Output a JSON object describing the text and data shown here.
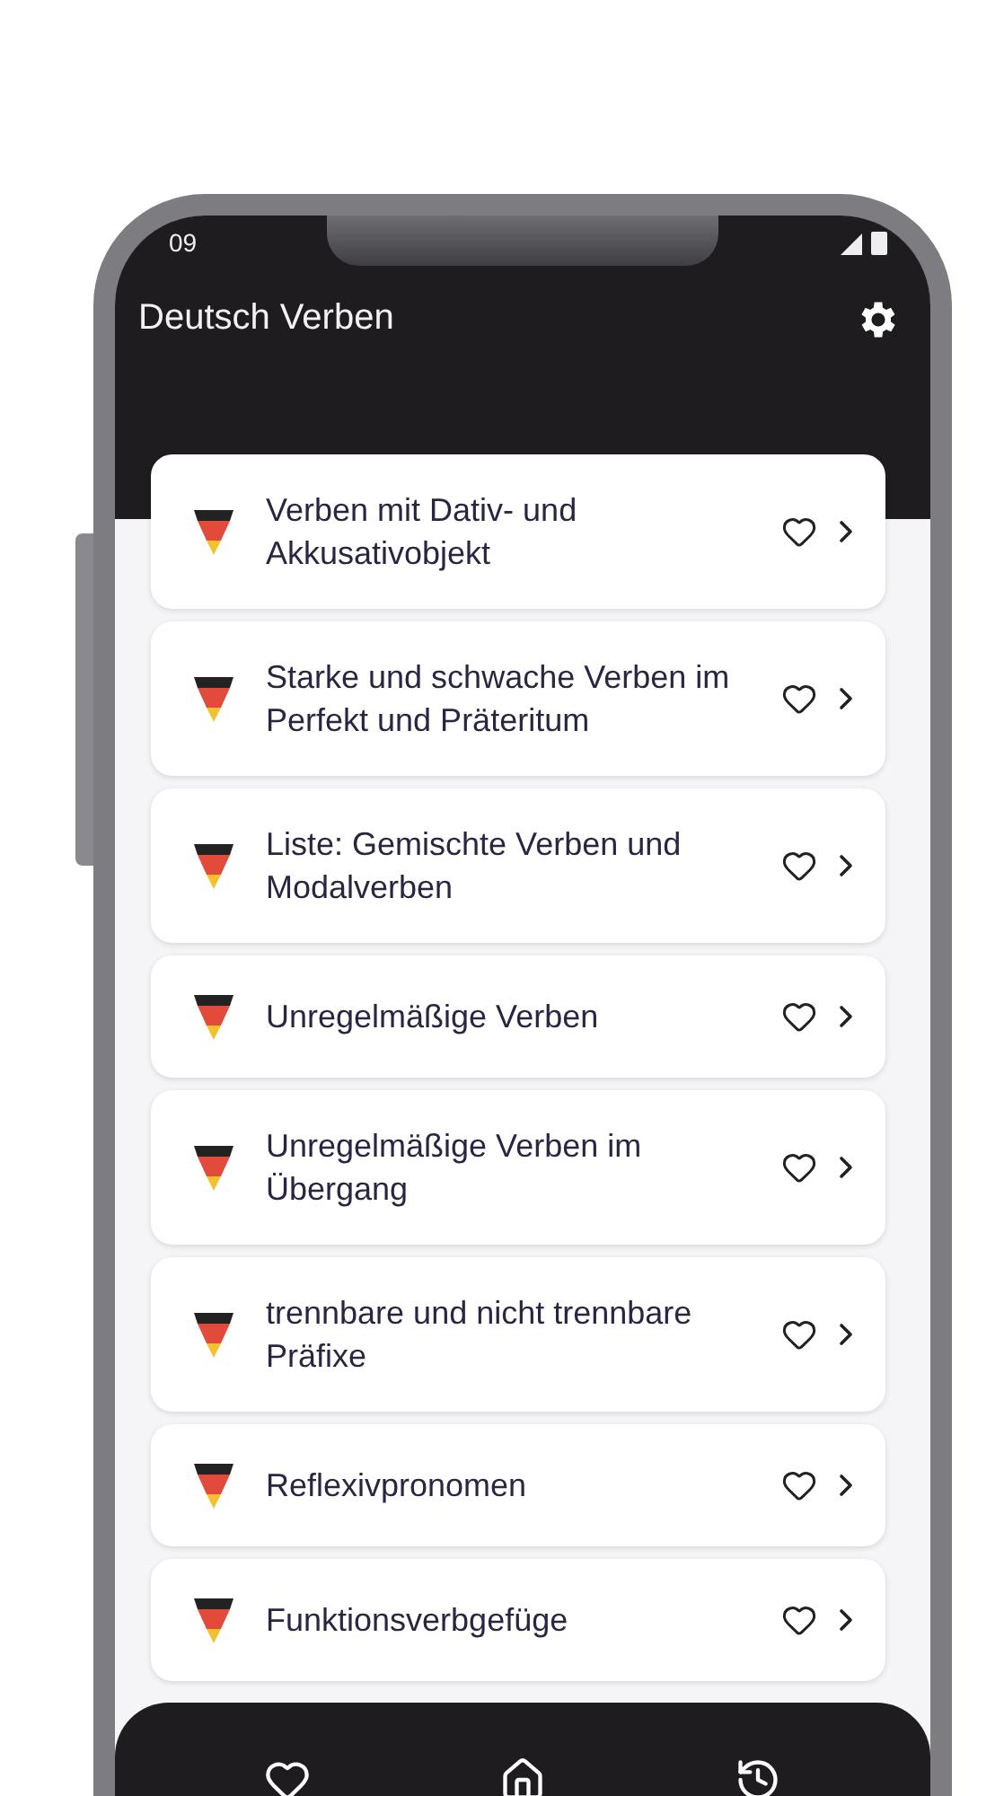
{
  "status_bar": {
    "time": "09"
  },
  "app_bar": {
    "title": "Deutsch Verben"
  },
  "topics": [
    {
      "title": "Verben mit Dativ- und Akkusativobjekt"
    },
    {
      "title": "Starke und schwache Verben im Perfekt und Präteritum"
    },
    {
      "title": "Liste: Gemischte Verben und Modalverben"
    },
    {
      "title": "Unregelmäßige Verben"
    },
    {
      "title": "Unregelmäßige Verben im Übergang"
    },
    {
      "title": "trennbare und nicht trennbare Präfixe"
    },
    {
      "title": "Reflexivpronomen"
    },
    {
      "title": "Funktionsverbgefüge"
    }
  ],
  "bottom_nav": [
    {
      "kind": "favorites"
    },
    {
      "kind": "home"
    },
    {
      "kind": "history"
    }
  ]
}
